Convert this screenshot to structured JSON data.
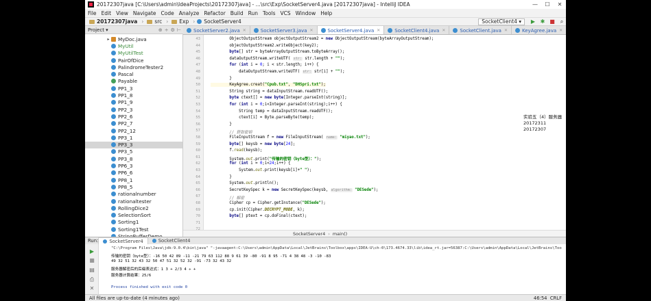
{
  "window": {
    "title": "20172307java [C:\\Users\\admin\\IdeaProjects\\20172307java] - ...\\src\\Exp\\SocketServer4.java [20172307java] - IntelliJ IDEA",
    "buttons": {
      "minimize": "—",
      "maximize": "☐",
      "close": "✕"
    }
  },
  "menu": [
    "File",
    "Edit",
    "View",
    "Navigate",
    "Code",
    "Analyze",
    "Refactor",
    "Build",
    "Run",
    "Tools",
    "VCS",
    "Window",
    "Help"
  ],
  "navbar": {
    "crumbs": [
      "20172307java",
      "src",
      "Exp",
      "SocketServer4"
    ],
    "run_config": "SocketClient4"
  },
  "project": {
    "header": "Project",
    "items": [
      {
        "label": "MyDoc.java",
        "icon": "java-file-icon",
        "selected": false
      },
      {
        "label": "MyUtil",
        "icon": "class-icon",
        "selected": false
      },
      {
        "label": "MyUtilTest",
        "icon": "class-icon",
        "selected": false
      },
      {
        "label": "PairOfDice",
        "icon": "class-icon",
        "selected": false
      },
      {
        "label": "PalindromeTester2",
        "icon": "class-icon",
        "selected": false
      },
      {
        "label": "Pascal",
        "icon": "class-icon",
        "selected": false
      },
      {
        "label": "Payable",
        "icon": "interface-icon",
        "selected": false
      },
      {
        "label": "PP1_3",
        "icon": "class-icon",
        "selected": false
      },
      {
        "label": "PP1_8",
        "icon": "class-icon",
        "selected": false
      },
      {
        "label": "PP1_9",
        "icon": "class-icon",
        "selected": false
      },
      {
        "label": "PP2_3",
        "icon": "class-icon",
        "selected": false
      },
      {
        "label": "PP2_6",
        "icon": "class-icon",
        "selected": false
      },
      {
        "label": "PP2_7",
        "icon": "class-icon",
        "selected": false
      },
      {
        "label": "PP2_12",
        "icon": "class-icon",
        "selected": false
      },
      {
        "label": "PP3_1",
        "icon": "class-icon",
        "selected": false
      },
      {
        "label": "PP3_3",
        "icon": "class-icon",
        "selected": true
      },
      {
        "label": "PP3_5",
        "icon": "class-icon",
        "selected": false
      },
      {
        "label": "PP3_8",
        "icon": "class-icon",
        "selected": false
      },
      {
        "label": "PP6_3",
        "icon": "class-icon",
        "selected": false
      },
      {
        "label": "PP6_6",
        "icon": "class-icon",
        "selected": false
      },
      {
        "label": "PP8_1",
        "icon": "class-icon",
        "selected": false
      },
      {
        "label": "PP8_5",
        "icon": "class-icon",
        "selected": false
      },
      {
        "label": "rationalnumber",
        "icon": "class-icon",
        "selected": false
      },
      {
        "label": "rationaltester",
        "icon": "class-icon",
        "selected": false
      },
      {
        "label": "RollingDice2",
        "icon": "class-icon",
        "selected": false
      },
      {
        "label": "SelectionSort",
        "icon": "class-icon",
        "selected": false
      },
      {
        "label": "Sorting1",
        "icon": "class-icon",
        "selected": false
      },
      {
        "label": "Sorting1Test",
        "icon": "class-icon",
        "selected": false
      },
      {
        "label": "StringBufferDemo",
        "icon": "class-icon",
        "selected": false
      }
    ]
  },
  "tabs": [
    {
      "label": "SocketServer2.java",
      "active": false
    },
    {
      "label": "SocketServer3.java",
      "active": false
    },
    {
      "label": "SocketServer4.java",
      "active": true
    },
    {
      "label": "SocketClient4.java",
      "active": false
    },
    {
      "label": "SocketClient.java",
      "active": false
    },
    {
      "label": "KeyAgree.java",
      "active": false
    },
    {
      "label": "Key_DH.java",
      "active": false
    }
  ],
  "editor": {
    "line_numbers": [
      "43",
      "44",
      "45",
      "46",
      "47",
      "48",
      "49",
      "50",
      "51",
      "52",
      "53",
      "54",
      "55",
      "56",
      "57",
      "58",
      "59",
      "60",
      "61",
      "62",
      "63",
      "64",
      "65",
      "66",
      "67",
      "68",
      "69",
      "70",
      "71",
      "72",
      "73"
    ],
    "note_lines": [
      "实验五（4）服务器",
      "20172311",
      "20172307"
    ],
    "crumb": [
      "SocketServer4",
      "main()"
    ]
  },
  "run": {
    "label": "Run:",
    "tabs": [
      "SocketServer4",
      "SocketClient4"
    ],
    "console": [
      "\"C:\\Program Files\\Java\\jdk-9.0.4\\bin\\java\" \"-javaagent:C:\\Users\\admin\\AppData\\Local\\JetBrains\\Toolbox\\apps\\IDEA-U\\ch-0\\173.4674.33\\lib\\idea_rt.jar=56387:C:\\Users\\admin\\AppData\\Local\\JetBrains\\Too",
      "传输的密钥（byte型）：-16 50 42 89 -11 -21 79 63 112 88 9 61 39 -80 -91 8 95 -71 4 38 48 -3 -10 -83",
      "49 32 51 32 43 32 50 47 51 32 52 32 -91 -73 32 43 32",
      "服务器解密后的后缀表达式：1 3 + 2/3 4 ÷ +",
      "服务器计算结果：25/6",
      "",
      "Process finished with exit code 0"
    ]
  },
  "status": {
    "message": "All files are up-to-date (4 minutes ago)",
    "position": "46:54",
    "line_ending": "CRLF"
  }
}
